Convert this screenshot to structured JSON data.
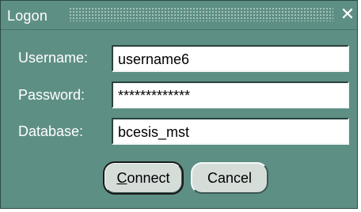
{
  "dialog": {
    "title": "Logon",
    "close_glyph": "✕"
  },
  "form": {
    "username": {
      "label": "Username:",
      "value": "username6"
    },
    "password": {
      "label": "Password:",
      "value": "*************"
    },
    "database": {
      "label": "Database:",
      "value": "bcesis_mst"
    }
  },
  "buttons": {
    "connect_mnemonic": "C",
    "connect_rest": "onnect",
    "cancel": "Cancel"
  },
  "colors": {
    "dialog_bg": "#5e8f85",
    "field_bg": "#ffffff",
    "button_bg": "#d5ddd9"
  }
}
